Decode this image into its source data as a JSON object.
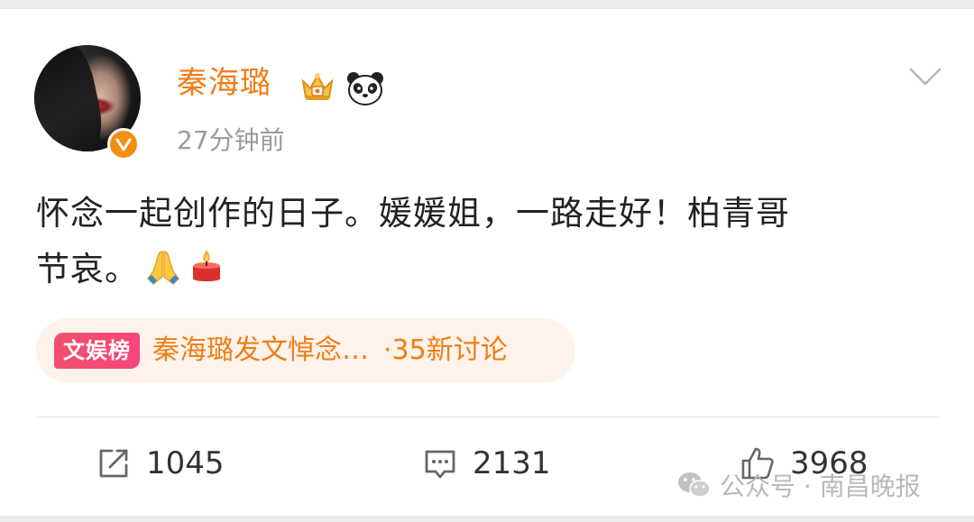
{
  "post": {
    "author": "秦海璐",
    "timestamp": "27分钟前",
    "text_line1": "怀念一起创作的日子。媛媛姐，一路走好！柏青哥",
    "text_line2": "节哀。",
    "emojis": [
      "folded-hands-icon",
      "candle-icon"
    ]
  },
  "topic": {
    "tag": "文娱榜",
    "title": "秦海璐发文悼念…",
    "count": "·35新讨论"
  },
  "actions": {
    "repost_count": "1045",
    "comment_count": "2131",
    "like_count": "3968"
  },
  "watermark": {
    "text": "公众号 · 南昌晚报"
  },
  "colors": {
    "name": "#f07d16",
    "verified": "#f58d12",
    "tag": "#f04f6e"
  }
}
